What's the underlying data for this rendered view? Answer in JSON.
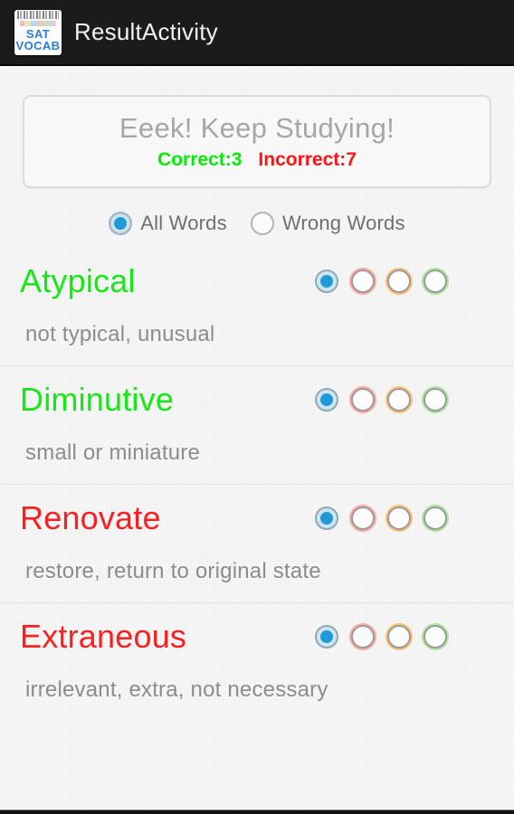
{
  "app": {
    "title": "ResultActivity",
    "icon_name": "sat-vocab-notepad-icon",
    "icon_line1": "SAT",
    "icon_line2": "VOCAB"
  },
  "result": {
    "headline": "Eeek! Keep Studying!",
    "correct_label": "Correct:3",
    "incorrect_label": "Incorrect:7",
    "correct_count": 3,
    "incorrect_count": 7,
    "correct_color": "#00ef00",
    "incorrect_color": "#ff1414"
  },
  "filter": {
    "options": [
      {
        "label": "All Words",
        "selected": true
      },
      {
        "label": "Wrong Words",
        "selected": false
      }
    ]
  },
  "words": [
    {
      "term": "Atypical",
      "definition": "not typical, unusual",
      "status": "correct",
      "choices": [
        {
          "state": "selected",
          "color": "#1f9ad6"
        },
        {
          "state": "empty",
          "color": "#ffa9a2"
        },
        {
          "state": "empty",
          "color": "#ffc071"
        },
        {
          "state": "empty",
          "color": "#aae79a"
        }
      ]
    },
    {
      "term": "Diminutive",
      "definition": "small or miniature",
      "status": "correct",
      "choices": [
        {
          "state": "selected",
          "color": "#1f9ad6"
        },
        {
          "state": "empty",
          "color": "#ffa9a2"
        },
        {
          "state": "empty",
          "color": "#ffc071"
        },
        {
          "state": "empty",
          "color": "#aae79a"
        }
      ]
    },
    {
      "term": "Renovate",
      "definition": "restore, return to original state",
      "status": "incorrect",
      "choices": [
        {
          "state": "selected",
          "color": "#1f9ad6"
        },
        {
          "state": "empty",
          "color": "#ffa9a2"
        },
        {
          "state": "empty",
          "color": "#ffc071"
        },
        {
          "state": "empty",
          "color": "#aae79a"
        }
      ]
    },
    {
      "term": "Extraneous",
      "definition": "irrelevant, extra, not necessary",
      "status": "incorrect",
      "choices": [
        {
          "state": "selected",
          "color": "#1f9ad6"
        },
        {
          "state": "empty",
          "color": "#ffa9a2"
        },
        {
          "state": "empty",
          "color": "#ffc071"
        },
        {
          "state": "empty",
          "color": "#aae79a"
        }
      ]
    }
  ]
}
